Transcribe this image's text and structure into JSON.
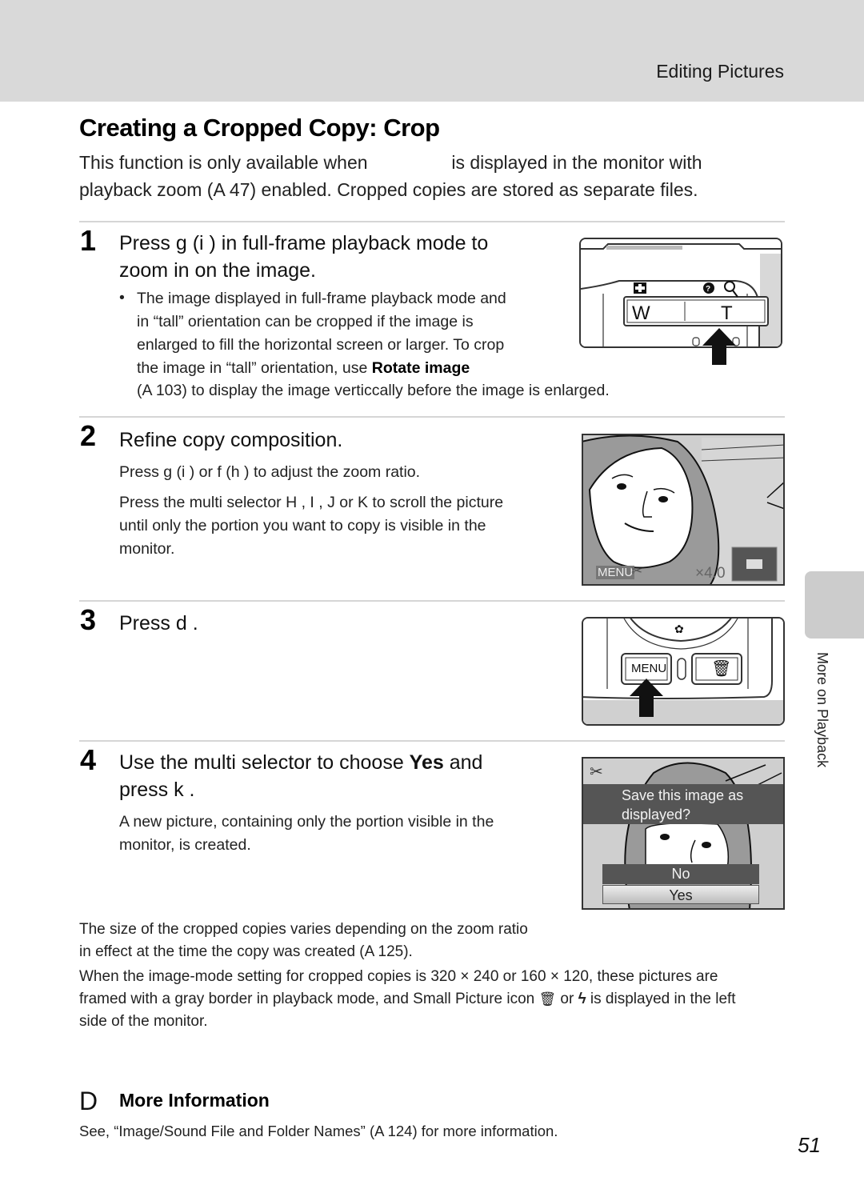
{
  "header": {
    "section": "Editing Pictures"
  },
  "page": {
    "title": "Creating a Cropped Copy: Crop",
    "intro_line1_a": "This function is only available when",
    "intro_line1_b": "is displayed in the monitor with",
    "intro_line2": "playback zoom (A  47) enabled. Cropped copies are stored as separate files."
  },
  "steps": [
    {
      "number": "1",
      "heading_line1": "Press g  (i  ) in full-frame playback mode to",
      "heading_line2": "zoom in on the image.",
      "bullet": "•",
      "bullet_lines": [
        "The image displayed in full-frame playback mode and",
        "in “tall” orientation can be cropped if the image is",
        "enlarged to fill the horizontal screen or larger. To crop",
        "the image in “tall” orientation, use "
      ],
      "bullet_bold": "Rotate image",
      "continuation": "(A  103) to display the image verticcally before the image is enlarged.",
      "illustration": {
        "left_label": "W",
        "right_label": "T",
        "icons": [
          "thumbnail-icon",
          "help-icon",
          "zoom-icon"
        ]
      }
    },
    {
      "number": "2",
      "heading": "Refine copy composition.",
      "para1": "Press g  (i  ) or f    (h   ) to adjust the zoom ratio.",
      "para2_lines": [
        "Press the multi selector H , I   , J   or K  to scroll the picture",
        "until only the portion you want to copy is visible in the",
        "monitor."
      ],
      "screen": {
        "menu_label": "MENU",
        "zoom_ratio": "×4.0"
      }
    },
    {
      "number": "3",
      "heading": "Press d     .",
      "illustration": {
        "menu_button": "MENU"
      }
    },
    {
      "number": "4",
      "heading_a": "Use the multi selector to choose ",
      "heading_bold": "Yes",
      "heading_b": " and",
      "heading_line2": "press k   .",
      "para_lines": [
        "A new picture, containing only the portion visible in the",
        "monitor, is created."
      ],
      "screen": {
        "prompt_line1": "Save this image as",
        "prompt_line2": "displayed?",
        "options": [
          "No",
          "Yes"
        ],
        "selected": "Yes"
      }
    }
  ],
  "notes": {
    "size_lines": [
      "The size of the cropped copies varies depending on the zoom ratio",
      "in effect at the time the copy was created (A  125)."
    ],
    "mode_lines": [
      "When the image-mode setting for cropped copies is 320 × 240 or 160 × 120, these pictures are",
      "framed with a gray border in playback mode, and Small Picture icon",
      "or",
      "is displayed in the left",
      "side of the monitor."
    ]
  },
  "more_info": {
    "marker": "D",
    "title": "More Information",
    "text": "See, “Image/Sound File and Folder Names” (A  124) for more information."
  },
  "side_tab": {
    "label": "More on Playback"
  },
  "page_number": "51",
  "colors": {
    "header_band": "#d9d9d9",
    "side_tab": "#cccccc",
    "divider": "#d6d6d6"
  }
}
